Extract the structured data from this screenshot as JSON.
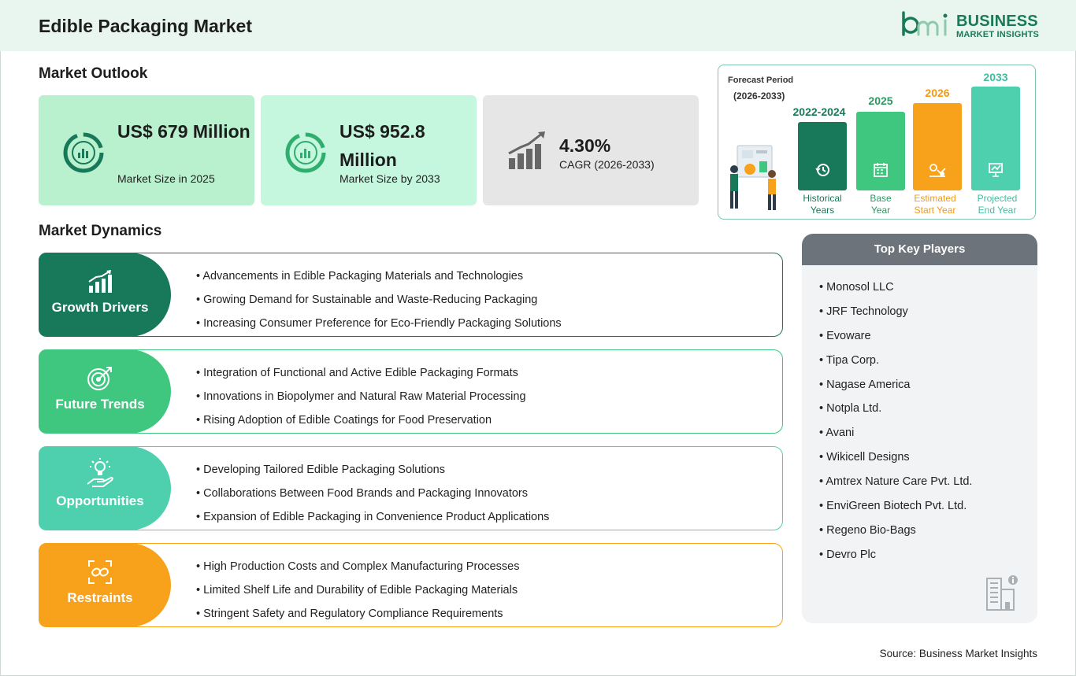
{
  "header": {
    "title": "Edible Packaging Market",
    "logo_line1": "BUSINESS",
    "logo_line2": "MARKET INSIGHTS",
    "logo_mark": "bmi"
  },
  "outlook": {
    "title": "Market Outlook",
    "stats": [
      {
        "value": "US$ 679 Million",
        "label": "Market Size in 2025",
        "bg": "#b9f0cd",
        "icon": "pie-chart-icon"
      },
      {
        "value": "US$ 952.8 Million",
        "label": "Market Size by 2033",
        "bg": "#c5f7df",
        "icon": "pie-chart-icon"
      },
      {
        "value": "4.30%",
        "label": "CAGR (2026-2033)",
        "bg": "#e6e6e6",
        "icon": "growth-chart-icon"
      }
    ]
  },
  "forecast": {
    "period_label": "Forecast Period",
    "period_range": "(2026-2033)",
    "bars": [
      {
        "year": "2022-2024",
        "label_line1": "Historical",
        "label_line2": "Years",
        "color": "#17785a",
        "text_color": "#17785a",
        "icon": "history-icon"
      },
      {
        "year": "2025",
        "label_line1": "Base",
        "label_line2": "Year",
        "color": "#3fc67f",
        "text_color": "#2a9a62",
        "icon": "calendar-icon"
      },
      {
        "year": "2026",
        "label_line1": "Estimated",
        "label_line2": "Start Year",
        "color": "#f8a11b",
        "text_color": "#f39a14",
        "icon": "estimate-icon"
      },
      {
        "year": "2033",
        "label_line1": "Projected",
        "label_line2": "End Year",
        "color": "#4ecfae",
        "text_color": "#3fbf9f",
        "icon": "presentation-icon"
      }
    ]
  },
  "dynamics": {
    "title": "Market Dynamics",
    "sections": [
      {
        "name": "Growth Drivers",
        "color": "#17785a",
        "icon": "growth-bars-icon",
        "items": [
          "Advancements in Edible Packaging Materials and Technologies",
          "Growing Demand for Sustainable and Waste-Reducing Packaging",
          "Increasing Consumer Preference for Eco-Friendly Packaging Solutions"
        ]
      },
      {
        "name": "Future Trends",
        "color": "#3fc67f",
        "icon": "target-icon",
        "items": [
          "Integration of Functional and Active Edible Packaging Formats",
          "Innovations in Biopolymer and Natural Raw Material Processing",
          "Rising Adoption of Edible Coatings for Food Preservation"
        ]
      },
      {
        "name": "Opportunities",
        "color": "#4ecfae",
        "icon": "lightbulb-hand-icon",
        "items": [
          "Developing Tailored Edible Packaging Solutions",
          "Collaborations Between Food Brands and Packaging Innovators",
          "Expansion of Edible Packaging in Convenience Product Applications"
        ]
      },
      {
        "name": "Restraints",
        "color": "#f8a11b",
        "icon": "broken-chain-icon",
        "items": [
          "High Production Costs and Complex Manufacturing Processes",
          "Limited Shelf Life and Durability of Edible Packaging Materials",
          "Stringent Safety and Regulatory Compliance Requirements"
        ]
      }
    ]
  },
  "players": {
    "title": "Top Key Players",
    "items": [
      "Monosol LLC",
      "JRF Technology",
      "Evoware",
      "Tipa Corp.",
      "Nagase America",
      "Notpla Ltd.",
      "Avani",
      "Wikicell Designs",
      "Amtrex Nature Care Pvt. Ltd.",
      "EnviGreen Biotech Pvt. Ltd.",
      "Regeno Bio-Bags",
      "Devro Plc"
    ]
  },
  "source": "Source: Business Market Insights"
}
